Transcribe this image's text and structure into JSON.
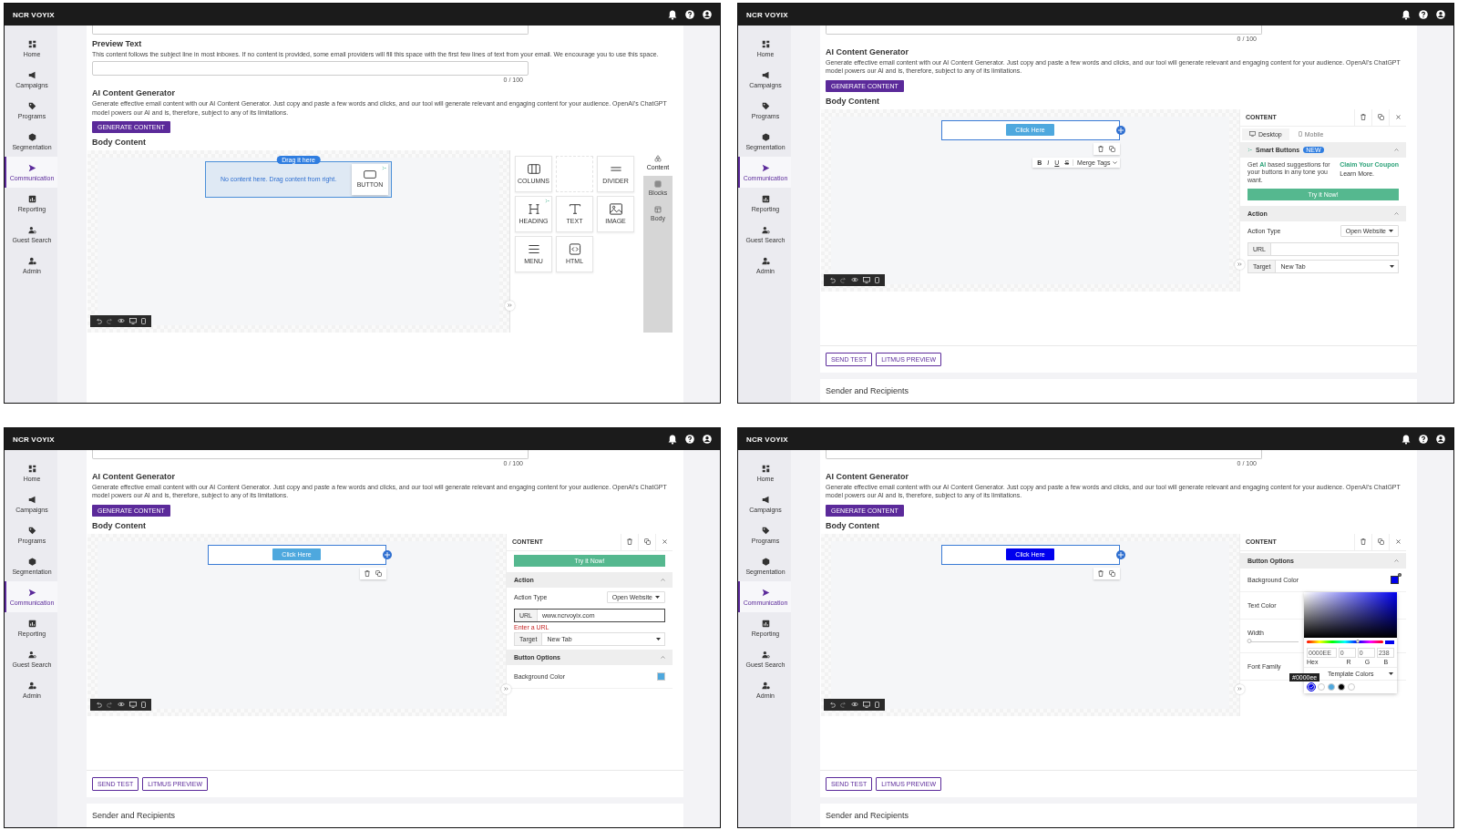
{
  "panels": [
    {
      "brand": "NCR VOYIX",
      "nav": [
        {
          "label": "Home",
          "selected": false
        },
        {
          "label": "Campaigns",
          "selected": false
        },
        {
          "label": "Programs",
          "selected": false
        },
        {
          "label": "Segmentation",
          "selected": false
        },
        {
          "label": "Communication",
          "selected": true
        },
        {
          "label": "Reporting",
          "selected": false
        },
        {
          "label": "Guest Search",
          "selected": false
        },
        {
          "label": "Admin",
          "selected": false
        }
      ],
      "form": [
        {
          "kind": "input_tail"
        },
        {
          "kind": "heading",
          "text": "Preview Text"
        },
        {
          "kind": "help",
          "text": "This content follows the subject line in most inboxes. If no content is provided, some email providers will fill this space with the first few lines of text from your email. We encourage you to use this space."
        },
        {
          "kind": "input"
        },
        {
          "kind": "counter",
          "text": "0 / 100"
        },
        {
          "kind": "heading",
          "text": "AI Content Generator"
        },
        {
          "kind": "help",
          "text": "Generate effective email content with our AI Content Generator. Just copy and paste a few words and clicks, and our tool will generate relevant and engaging content for your audience. OpenAI's ChatGPT model powers our AI and is, therefore, subject to any of its limitations."
        },
        {
          "kind": "button",
          "text": "GENERATE CONTENT"
        },
        {
          "kind": "heading",
          "text": "Body Content"
        }
      ],
      "canvas": {
        "kind": "drop_zone",
        "pill": "Drag it here",
        "message": "No content here. Drag content from right.",
        "dragged_tile": "BUTTON"
      },
      "side": {
        "kind": "blocks",
        "tiles": [
          {
            "kind": "block",
            "label": "COLUMNS",
            "ai": false
          },
          {
            "kind": "empty"
          },
          {
            "kind": "block",
            "label": "DIVIDER",
            "ai": false
          },
          {
            "kind": "block",
            "label": "HEADING",
            "ai": true
          },
          {
            "kind": "block",
            "label": "TEXT",
            "ai": false
          },
          {
            "kind": "block",
            "label": "IMAGE",
            "ai": false
          },
          {
            "kind": "block",
            "label": "MENU",
            "ai": false
          },
          {
            "kind": "block",
            "label": "HTML",
            "ai": false
          }
        ],
        "tabs": [
          {
            "label": "Content",
            "selected": true
          },
          {
            "label": "Blocks",
            "selected": false
          },
          {
            "label": "Body",
            "selected": false
          }
        ]
      }
    },
    {
      "brand": "NCR VOYIX",
      "nav": [
        {
          "label": "Home",
          "selected": false
        },
        {
          "label": "Campaigns",
          "selected": false
        },
        {
          "label": "Programs",
          "selected": false
        },
        {
          "label": "Segmentation",
          "selected": false
        },
        {
          "label": "Communication",
          "selected": true
        },
        {
          "label": "Reporting",
          "selected": false
        },
        {
          "label": "Guest Search",
          "selected": false
        },
        {
          "label": "Admin",
          "selected": false
        }
      ],
      "form": [
        {
          "kind": "input_tail"
        },
        {
          "kind": "counter",
          "text": "0 / 100"
        },
        {
          "kind": "heading",
          "text": "AI Content Generator"
        },
        {
          "kind": "help",
          "text": "Generate effective email content with our AI Content Generator. Just copy and paste a few words and clicks, and our tool will generate relevant and engaging content for your audience. OpenAI's ChatGPT model powers our AI and is, therefore, subject to any of its limitations."
        },
        {
          "kind": "button",
          "text": "GENERATE CONTENT"
        },
        {
          "kind": "heading",
          "text": "Body Content"
        }
      ],
      "canvas": {
        "kind": "button_row",
        "button": {
          "label": "Click Here",
          "color": "#4ea8de"
        },
        "format_bar": {
          "marks": [
            "B",
            "I",
            "U",
            "S"
          ],
          "merge": "Merge Tags"
        }
      },
      "side": {
        "kind": "properties",
        "title": "CONTENT",
        "items": [
          {
            "kind": "tabs",
            "tabs": [
              {
                "label": "Desktop",
                "selected": true
              },
              {
                "label": "Mobile",
                "selected": false
              }
            ]
          },
          {
            "kind": "section",
            "title": "Smart Buttons",
            "badge": "NEW",
            "expanded": true
          },
          {
            "kind": "promo",
            "text": "Get **AI** based suggestions for your buttons in any tone you want.",
            "link": "Claim Your Coupon",
            "note": "Learn More."
          },
          {
            "kind": "action_button",
            "label": "Try it Now!"
          },
          {
            "kind": "section",
            "title": "Action",
            "expanded": true
          },
          {
            "kind": "select",
            "label": "Action Type",
            "value": "Open Website"
          },
          {
            "kind": "addon_input",
            "addon": "URL",
            "focused": false
          },
          {
            "kind": "addon_select",
            "addon": "Target",
            "value": "New Tab"
          }
        ]
      },
      "footer": {
        "buttons": [
          "SEND TEST",
          "LITMUS PREVIEW"
        ],
        "next_section": "Sender and Recipients"
      }
    },
    {
      "brand": "NCR VOYIX",
      "nav": [
        {
          "label": "Home",
          "selected": false
        },
        {
          "label": "Campaigns",
          "selected": false
        },
        {
          "label": "Programs",
          "selected": false
        },
        {
          "label": "Segmentation",
          "selected": false
        },
        {
          "label": "Communication",
          "selected": true
        },
        {
          "label": "Reporting",
          "selected": false
        },
        {
          "label": "Guest Search",
          "selected": false
        },
        {
          "label": "Admin",
          "selected": false
        }
      ],
      "form": [
        {
          "kind": "input_tail"
        },
        {
          "kind": "counter",
          "text": "0 / 100"
        },
        {
          "kind": "heading",
          "text": "AI Content Generator"
        },
        {
          "kind": "help",
          "text": "Generate effective email content with our AI Content Generator. Just copy and paste a few words and clicks, and our tool will generate relevant and engaging content for your audience. OpenAI's ChatGPT model powers our AI and is, therefore, subject to any of its limitations."
        },
        {
          "kind": "button",
          "text": "GENERATE CONTENT"
        },
        {
          "kind": "heading",
          "text": "Body Content"
        }
      ],
      "canvas": {
        "kind": "button_row",
        "button": {
          "label": "Click Here",
          "color": "#4ea8de"
        }
      },
      "side": {
        "kind": "properties",
        "title": "CONTENT",
        "items": [
          {
            "kind": "action_button",
            "label": "Try it Now!"
          },
          {
            "kind": "section",
            "title": "Action",
            "expanded": true
          },
          {
            "kind": "select",
            "label": "Action Type",
            "value": "Open Website"
          },
          {
            "kind": "addon_input",
            "addon": "URL",
            "value": "www.ncrvoyix.com",
            "focused": true
          },
          {
            "kind": "error",
            "text": "Enter a URL"
          },
          {
            "kind": "addon_select",
            "addon": "Target",
            "value": "New Tab"
          },
          {
            "kind": "section",
            "title": "Button Options",
            "expanded": true
          },
          {
            "kind": "color",
            "label": "Background Color",
            "color": "#4ea8de",
            "open": false
          }
        ]
      },
      "footer": {
        "buttons": [
          "SEND TEST",
          "LITMUS PREVIEW"
        ],
        "next_section": "Sender and Recipients"
      }
    },
    {
      "brand": "NCR VOYIX",
      "nav": [
        {
          "label": "Home",
          "selected": false
        },
        {
          "label": "Campaigns",
          "selected": false
        },
        {
          "label": "Programs",
          "selected": false
        },
        {
          "label": "Segmentation",
          "selected": false
        },
        {
          "label": "Communication",
          "selected": true
        },
        {
          "label": "Reporting",
          "selected": false
        },
        {
          "label": "Guest Search",
          "selected": false
        },
        {
          "label": "Admin",
          "selected": false
        }
      ],
      "form": [
        {
          "kind": "input_tail"
        },
        {
          "kind": "counter",
          "text": "0 / 100"
        },
        {
          "kind": "heading",
          "text": "AI Content Generator"
        },
        {
          "kind": "help",
          "text": "Generate effective email content with our AI Content Generator. Just copy and paste a few words and clicks, and our tool will generate relevant and engaging content for your audience. OpenAI's ChatGPT model powers our AI and is, therefore, subject to any of its limitations."
        },
        {
          "kind": "button",
          "text": "GENERATE CONTENT"
        },
        {
          "kind": "heading",
          "text": "Body Content"
        }
      ],
      "canvas": {
        "kind": "button_row",
        "button": {
          "label": "Click Here",
          "color": "#0000ee"
        }
      },
      "side": {
        "kind": "properties",
        "title": "CONTENT",
        "items": [
          {
            "kind": "section",
            "title": "Button Options",
            "expanded": true
          },
          {
            "kind": "color",
            "label": "Background Color",
            "color": "#0000ee",
            "open": true
          },
          {
            "kind": "label",
            "label": "Text Color"
          },
          {
            "kind": "slider",
            "label": "Width",
            "level": 0
          },
          {
            "kind": "label",
            "label": "Font Family"
          }
        ],
        "picker": {
          "level": 0.667,
          "hex": "0000EE",
          "r": "0",
          "g": "0",
          "b": "238",
          "field_labels": [
            "Hex",
            "R",
            "G",
            "B"
          ],
          "preset_label": "Template Colors",
          "tooltip": "#0000ee",
          "swatches": [
            {
              "color": "#0000ee",
              "selected": true
            },
            {
              "color": "#ffffff",
              "selected": false
            },
            {
              "color": "#4ea8de",
              "selected": false
            },
            {
              "color": "#000000",
              "selected": false
            },
            {
              "color": "#ffffff",
              "selected": false
            }
          ]
        }
      },
      "footer": {
        "buttons": [
          "SEND TEST",
          "LITMUS PREVIEW"
        ],
        "next_section": "Sender and Recipients"
      }
    }
  ]
}
